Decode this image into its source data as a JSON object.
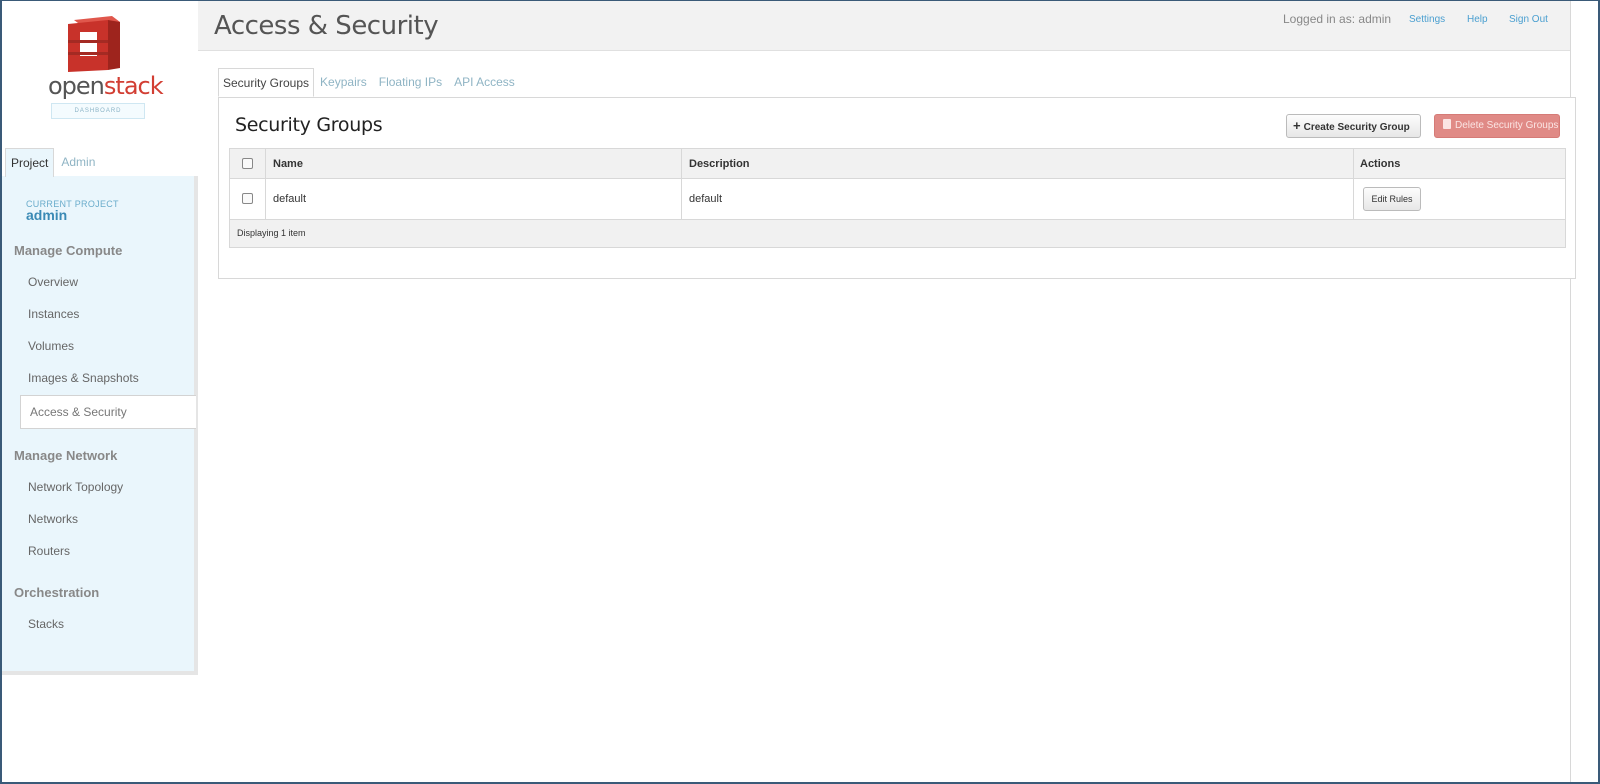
{
  "brand": {
    "logo_open": "open",
    "logo_stack": "stack",
    "logo_sub": "DASHBOARD",
    "logo_red": "#d23e33"
  },
  "sidebar": {
    "tabs": [
      "Project",
      "Admin"
    ],
    "current_project_label": "CURRENT PROJECT",
    "current_project_name": "admin",
    "sections": [
      {
        "title": "Manage Compute",
        "items": [
          "Overview",
          "Instances",
          "Volumes",
          "Images & Snapshots",
          "Access & Security"
        ]
      },
      {
        "title": "Manage Network",
        "items": [
          "Network Topology",
          "Networks",
          "Routers"
        ]
      },
      {
        "title": "Orchestration",
        "items": [
          "Stacks"
        ]
      }
    ],
    "active_item": "Access & Security"
  },
  "header": {
    "title": "Access & Security",
    "logged_in": "Logged in as: admin",
    "links": [
      "Settings",
      "Help",
      "Sign Out"
    ]
  },
  "content_tabs": [
    "Security Groups",
    "Keypairs",
    "Floating IPs",
    "API Access"
  ],
  "panel": {
    "title": "Security Groups",
    "create_button": "Create Security Group",
    "delete_button": "Delete Security Groups",
    "columns": [
      "Name",
      "Description",
      "Actions"
    ],
    "rows": [
      {
        "name": "default",
        "description": "default",
        "action": "Edit Rules"
      }
    ],
    "footer": "Displaying 1 item"
  }
}
